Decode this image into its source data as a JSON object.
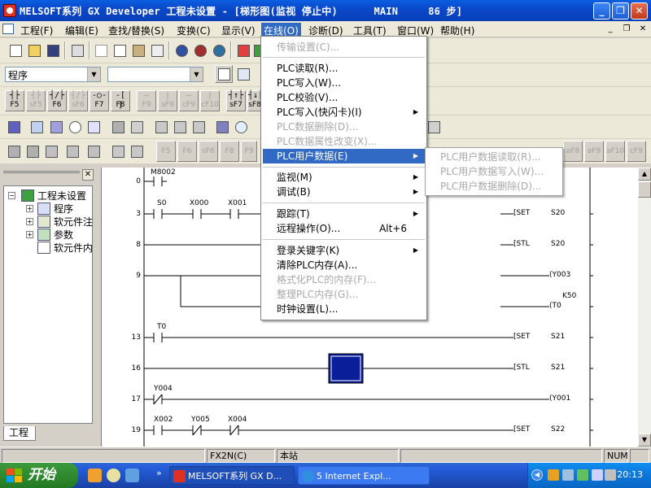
{
  "window": {
    "title": "MELSOFT系列 GX Developer 工程未设置 - [梯形图(监视 停止中)      MAIN     86 步]",
    "min_label": "_",
    "max_label": "❐",
    "close_label": "✕"
  },
  "menubar": {
    "items": [
      {
        "label": "工程(F)"
      },
      {
        "label": "编辑(E)"
      },
      {
        "label": "查找/替换(S)"
      },
      {
        "label": "变换(C)"
      },
      {
        "label": "显示(V)"
      },
      {
        "label": "在线(O)"
      },
      {
        "label": "诊断(D)"
      },
      {
        "label": "工具(T)"
      },
      {
        "label": "窗口(W)"
      },
      {
        "label": "帮助(H)"
      }
    ],
    "mdi_controls": [
      "_",
      "❐",
      "✕"
    ]
  },
  "toolbar": {
    "program_combo": "程序",
    "second_combo": ""
  },
  "fkeys_row1": [
    {
      "sym": "┤├",
      "label": "F5",
      "disabled": false
    },
    {
      "sym": "┤├",
      "label": "sF5",
      "disabled": true
    },
    {
      "sym": "┤/├",
      "label": "F6",
      "disabled": false
    },
    {
      "sym": "┤/├",
      "label": "sF6",
      "disabled": true
    },
    {
      "sym": "-○-",
      "label": "F7",
      "disabled": false
    },
    {
      "sym": "-[ ]",
      "label": "F8",
      "disabled": false
    },
    {
      "sym": "—",
      "label": "F9",
      "disabled": true
    },
    {
      "sym": "|",
      "label": "sF9",
      "disabled": true
    },
    {
      "sym": "—",
      "label": "cF9",
      "disabled": true
    },
    {
      "sym": "|",
      "label": "cF10",
      "disabled": true
    },
    {
      "sym": "┤↑├",
      "label": "sF7",
      "disabled": false
    },
    {
      "sym": "┤↓├",
      "label": "sF8",
      "disabled": false
    }
  ],
  "fkeys_row4_right": [
    "aF8",
    "aF9",
    "aF10",
    "cF9"
  ],
  "fkeys_row4_left": [
    "F5",
    "F6",
    "sF6",
    "F8",
    "F9"
  ],
  "project_tree": {
    "root": "工程未设置",
    "items": [
      {
        "label": "程序",
        "expandable": true
      },
      {
        "label": "软元件注",
        "expandable": true
      },
      {
        "label": "参数",
        "expandable": true
      },
      {
        "label": "软元件内",
        "expandable": false
      }
    ],
    "tab_label": "工程"
  },
  "online_menu": {
    "items": [
      {
        "label": "传输设置(C)...",
        "disabled": true,
        "accel": "",
        "submenu": false
      },
      {
        "sep": true
      },
      {
        "label": "PLC读取(R)...",
        "disabled": false,
        "accel": "",
        "submenu": false
      },
      {
        "label": "PLC写入(W)...",
        "disabled": false,
        "accel": "",
        "submenu": false
      },
      {
        "label": "PLC校验(V)...",
        "disabled": false,
        "accel": "",
        "submenu": false
      },
      {
        "label": "PLC写入(快闪卡)(I)",
        "disabled": false,
        "accel": "",
        "submenu": true
      },
      {
        "label": "PLC数据删除(D)...",
        "disabled": true,
        "accel": "",
        "submenu": false
      },
      {
        "label": "PLC数据属性改变(X)...",
        "disabled": true,
        "accel": "",
        "submenu": false
      },
      {
        "label": "PLC用户数据(E)",
        "disabled": false,
        "accel": "",
        "submenu": true,
        "highlight": true
      },
      {
        "sep": true
      },
      {
        "label": "监视(M)",
        "disabled": false,
        "accel": "",
        "submenu": true
      },
      {
        "label": "调试(B)",
        "disabled": false,
        "accel": "",
        "submenu": true
      },
      {
        "sep": true
      },
      {
        "label": "跟踪(T)",
        "disabled": false,
        "accel": "",
        "submenu": true
      },
      {
        "label": "远程操作(O)...",
        "disabled": false,
        "accel": "Alt+6",
        "submenu": false
      },
      {
        "sep": true
      },
      {
        "label": "登录关键字(K)",
        "disabled": false,
        "accel": "",
        "submenu": true
      },
      {
        "label": "清除PLC内存(A)...",
        "disabled": false,
        "accel": "",
        "submenu": false
      },
      {
        "label": "格式化PLC的内存(F)...",
        "disabled": true,
        "accel": "",
        "submenu": false
      },
      {
        "label": "整理PLC内存(G)...",
        "disabled": true,
        "accel": "",
        "submenu": false
      },
      {
        "label": "时钟设置(L)...",
        "disabled": false,
        "accel": "",
        "submenu": false
      }
    ]
  },
  "user_data_submenu": {
    "items": [
      {
        "label": "PLC用户数据读取(R)...",
        "disabled": true
      },
      {
        "label": "PLC用户数据写入(W)...",
        "disabled": true
      },
      {
        "label": "PLC用户数据删除(D)...",
        "disabled": true
      }
    ]
  },
  "ladder": {
    "rungs": [
      {
        "step": "0",
        "contacts": [
          "M8002"
        ]
      },
      {
        "step": "3",
        "contacts": [
          "S0",
          "X000",
          "X001"
        ],
        "coil": "[SET",
        "operand": "S20"
      },
      {
        "step": "8",
        "coil": "[STL",
        "operand": "S20"
      },
      {
        "step": "9",
        "coil": "(Y003",
        "operand": ""
      },
      {
        "step": "",
        "coil": "(T0",
        "operand": "K50"
      },
      {
        "step": "13",
        "contacts": [
          "T0"
        ],
        "coil": "[SET",
        "operand": "S21"
      },
      {
        "step": "16",
        "coil": "[STL",
        "operand": "S21"
      },
      {
        "step": "17",
        "contacts": [
          "Y004"
        ],
        "coil": "(Y001",
        "operand": ""
      },
      {
        "step": "19",
        "contacts": [
          "X002",
          "Y005",
          "X004"
        ],
        "coil": "[SET",
        "operand": "S22"
      }
    ]
  },
  "statusbar": {
    "plc_type": "FX2N(C)",
    "station": "本站",
    "num": "NUM"
  },
  "taskbar": {
    "start_label": "开始",
    "tasks": [
      {
        "label": "MELSOFT系列 GX D..."
      },
      {
        "label": "5 Internet Expl..."
      }
    ],
    "clock": "20:13"
  }
}
